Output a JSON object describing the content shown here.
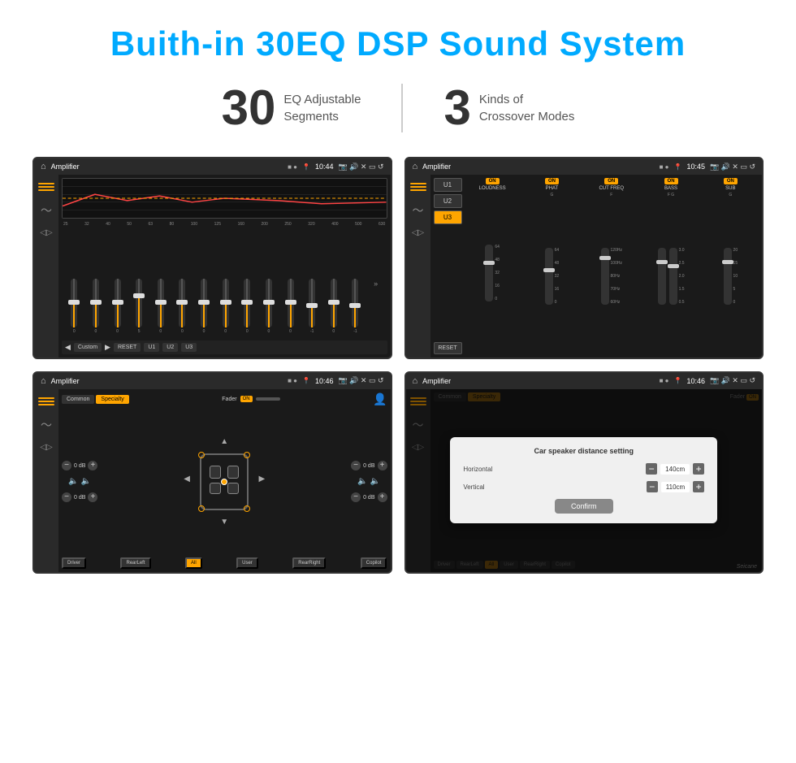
{
  "header": {
    "title": "Buith-in 30EQ DSP Sound System"
  },
  "stats": [
    {
      "number": "30",
      "desc_line1": "EQ Adjustable",
      "desc_line2": "Segments"
    },
    {
      "number": "3",
      "desc_line1": "Kinds of",
      "desc_line2": "Crossover Modes"
    }
  ],
  "screens": [
    {
      "id": "eq-screen",
      "status_bar": {
        "title": "Amplifier",
        "time": "10:44"
      },
      "eq_freqs": [
        "25",
        "32",
        "40",
        "50",
        "63",
        "80",
        "100",
        "125",
        "160",
        "200",
        "250",
        "320",
        "400",
        "500",
        "630"
      ],
      "eq_values": [
        "0",
        "0",
        "0",
        "5",
        "0",
        "0",
        "0",
        "0",
        "0",
        "0",
        "0",
        "-1",
        "0",
        "-1"
      ],
      "preset": "Custom",
      "buttons": [
        "RESET",
        "U1",
        "U2",
        "U3"
      ]
    },
    {
      "id": "crossover-screen",
      "status_bar": {
        "title": "Amplifier",
        "time": "10:45"
      },
      "channels": [
        {
          "name": "LOUDNESS",
          "on": true
        },
        {
          "name": "PHAT",
          "on": true
        },
        {
          "name": "CUT FREQ",
          "on": true
        },
        {
          "name": "BASS",
          "on": true
        },
        {
          "name": "SUB",
          "on": true
        }
      ],
      "u_buttons": [
        "U1",
        "U2",
        "U3"
      ],
      "active_u": "U3"
    },
    {
      "id": "specialty-screen",
      "status_bar": {
        "title": "Amplifier",
        "time": "10:46"
      },
      "tabs": [
        "Common",
        "Specialty"
      ],
      "active_tab": "Specialty",
      "fader": "Fader",
      "fader_on": "ON",
      "db_values": [
        "0 dB",
        "0 dB",
        "0 dB",
        "0 dB"
      ],
      "bottom_buttons": [
        "Driver",
        "RearLeft",
        "All",
        "User",
        "RearRight",
        "Copilot"
      ]
    },
    {
      "id": "dialog-screen",
      "status_bar": {
        "title": "Amplifier",
        "time": "10:46"
      },
      "dialog": {
        "title": "Car speaker distance setting",
        "fields": [
          {
            "label": "Horizontal",
            "value": "140cm"
          },
          {
            "label": "Vertical",
            "value": "110cm"
          }
        ],
        "confirm_label": "Confirm"
      },
      "tabs": [
        "Common",
        "Specialty"
      ],
      "active_tab": "Specialty",
      "bottom_buttons": [
        "Driver",
        "RearLeft",
        "All",
        "User",
        "RearRight",
        "Copilot"
      ]
    }
  ],
  "watermark": "Seicane"
}
